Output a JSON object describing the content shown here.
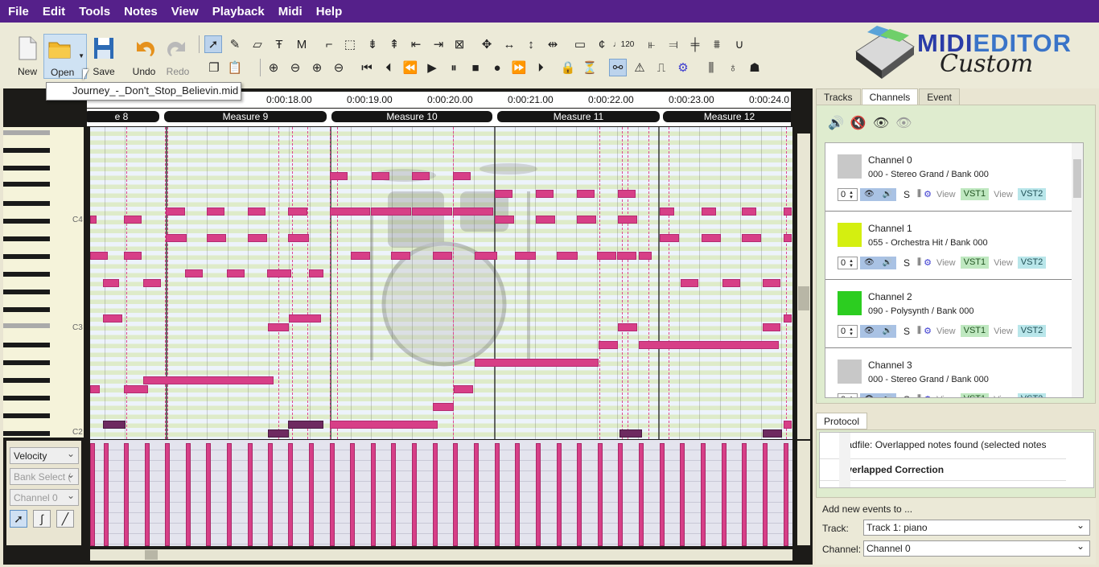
{
  "menu": [
    "File",
    "Edit",
    "Tools",
    "Notes",
    "View",
    "Playback",
    "Midi",
    "Help"
  ],
  "toolbar": {
    "new": "New",
    "open": "Open",
    "save": "Save",
    "undo": "Undo",
    "redo": "Redo"
  },
  "recent_file": "Journey_-_Don't_Stop_Believin.mid",
  "logo": {
    "line1a": "MIDI",
    "line1b": "EDITOR",
    "line2": "Custom"
  },
  "timeline": [
    "0:00:18.00",
    "0:00:19.00",
    "0:00:20.00",
    "0:00:21.00",
    "0:00:22.00",
    "0:00:23.00",
    "0:00:24.0"
  ],
  "measures": [
    "e 8",
    "Measure 9",
    "Measure 10",
    "Measure 11",
    "Measure 12"
  ],
  "piano_labels": [
    "C4",
    "C3",
    "C2"
  ],
  "controls": {
    "velocity": "Velocity",
    "bank": "Bank Select (",
    "channel": "Channel 0"
  },
  "side_tabs": [
    "Tracks",
    "Channels",
    "Event"
  ],
  "channels": [
    {
      "name": "Channel 0",
      "desc": "000 - Stereo Grand / Bank 000",
      "color": "#c8c8c8",
      "num": "0"
    },
    {
      "name": "Channel 1",
      "desc": "055 - Orchestra Hit / Bank 000",
      "color": "#d4ef10",
      "num": "0"
    },
    {
      "name": "Channel 2",
      "desc": "090 - Polysynth / Bank 000",
      "color": "#2ccd20",
      "num": "0"
    },
    {
      "name": "Channel 3",
      "desc": "000 - Stereo Grand / Bank 000",
      "color": "#c8c8c8",
      "num": "0"
    }
  ],
  "channel_ctrl": {
    "solo": "S",
    "view": "View",
    "vst1": "VST1",
    "vst2": "VST2"
  },
  "protocol": {
    "tab": "Protocol",
    "line1": "loadfile: Overlapped notes found (selected notes",
    "line2": "Overlapped Correction"
  },
  "add_events": {
    "title": "Add new events to ...",
    "track_label": "Track:",
    "track_value": "Track 1: piano",
    "channel_label": "Channel:",
    "channel_value": "Channel 0"
  }
}
